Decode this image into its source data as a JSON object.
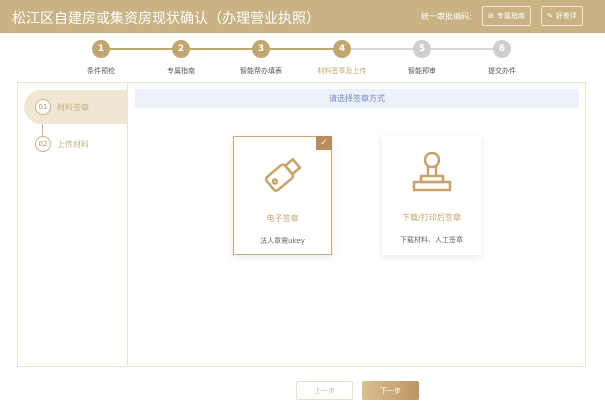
{
  "header": {
    "title": "松江区自建房或集资房现状确认（办理营业执照）",
    "code_label": "统一审批编码:",
    "guide_button": "专属指南",
    "rate_button": "好差评"
  },
  "steps": [
    {
      "num": "1",
      "label": "条件预检"
    },
    {
      "num": "2",
      "label": "专属指南"
    },
    {
      "num": "3",
      "label": "智能帮办填表"
    },
    {
      "num": "4",
      "label": "材料签章及上传"
    },
    {
      "num": "5",
      "label": "智能预审"
    },
    {
      "num": "6",
      "label": "提交办件"
    }
  ],
  "current_step": 4,
  "sidebar": {
    "items": [
      {
        "num": "01",
        "label": "材料签章"
      },
      {
        "num": "02",
        "label": "上传材料"
      }
    ]
  },
  "main": {
    "banner": "请选择签章方式",
    "cards": [
      {
        "title": "电子签章",
        "desc": "法人章需ukey"
      },
      {
        "title": "下载/打印后签章",
        "desc": "下载材料、人工签章"
      }
    ]
  },
  "footer": {
    "prev": "上一步",
    "next": "下一步"
  },
  "colors": {
    "brand": "#c9b284",
    "done": "#c2a66f",
    "pending": "#cfcfcf"
  }
}
